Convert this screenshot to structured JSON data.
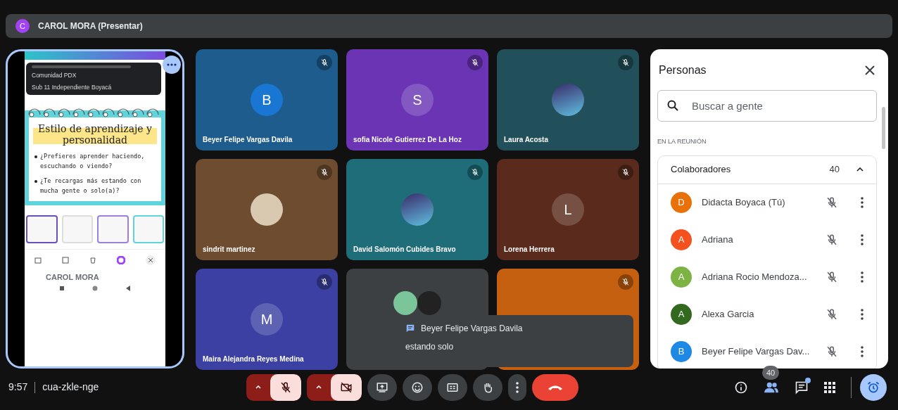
{
  "presenter_bar": {
    "initial": "C",
    "name": "CAROL MORA (Presentar)"
  },
  "shared_screen": {
    "notifications": [
      "Comunidad PDX",
      "Sub 11 Independiente Boyacá"
    ],
    "slide_title": "Estilo de aprendizaje y personalidad",
    "bullets": [
      "¿Prefieres aprender haciendo, escuchando o viendo?",
      "¿Te recargas más estando con mucha gente o solo(a)?"
    ],
    "presenter_label": "CAROL MORA"
  },
  "tiles": [
    {
      "kind": "letter",
      "name": "Beyer Felipe Vargas Davila",
      "initial": "B",
      "color": "#1d5c8c",
      "muted": true
    },
    {
      "kind": "letter",
      "name": "sofia Nicole Gutierrez De La Hoz",
      "initial": "S",
      "color": "#6a34b4",
      "muted": true
    },
    {
      "kind": "picture",
      "name": "Laura Acosta",
      "color": "#21505a",
      "muted": true
    },
    {
      "kind": "photo",
      "name": "sindrit martinez",
      "color": "#6e4c30",
      "muted": true
    },
    {
      "kind": "picture",
      "name": "David Salomón Cubides Bravo",
      "color": "#1e6d78",
      "muted": true
    },
    {
      "kind": "letter",
      "name": "Lorena Herrera",
      "initial": "L",
      "color": "#5a2a1c",
      "muted": true
    },
    {
      "kind": "letter",
      "name": "Maira Alejandra Reyes Medina",
      "initial": "M",
      "color": "#3b40a2",
      "muted": true
    },
    {
      "kind": "group",
      "color": "#3c4043",
      "muted": false
    },
    {
      "kind": "covered",
      "color": "#c4600f",
      "muted": true
    }
  ],
  "toast": {
    "sender": "Beyer Felipe Vargas Davila",
    "message": "estando solo"
  },
  "people_panel": {
    "title": "Personas",
    "search": {
      "placeholder": "Buscar a gente"
    },
    "section": "EN LA REUNIÓN",
    "group": {
      "label": "Colaboradores",
      "count": "40",
      "expanded": true
    },
    "participants": [
      {
        "initial": "D",
        "name": "Didacta Boyaca (Tú)",
        "color": "#e8710a",
        "muted": true
      },
      {
        "initial": "A",
        "name": "Adriana",
        "color": "#f4511e",
        "muted": true
      },
      {
        "initial": "A",
        "name": "Adriana Rocio Mendoza...",
        "color": "#7cb342",
        "muted": true
      },
      {
        "initial": "A",
        "name": "Alexa Garcia",
        "color": "#33691e",
        "muted": true
      },
      {
        "initial": "B",
        "name": "Beyer Felipe Vargas Dav...",
        "color": "#1e88e5",
        "muted": true
      }
    ]
  },
  "bottom_bar": {
    "time": "9:57",
    "meeting_code": "cua-zkle-nge",
    "controls": [
      {
        "kind": "mic",
        "on": false
      },
      {
        "kind": "camera",
        "on": false
      },
      {
        "kind": "present"
      },
      {
        "kind": "emoji"
      },
      {
        "kind": "captions"
      },
      {
        "kind": "hand"
      },
      {
        "kind": "more"
      },
      {
        "kind": "end"
      }
    ],
    "people_count": "40",
    "chat_unread": true,
    "activities_active": true
  }
}
